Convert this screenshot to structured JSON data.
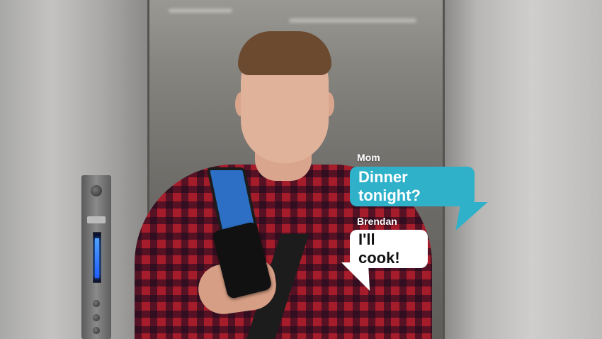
{
  "chat": {
    "incoming": {
      "sender": "Mom",
      "message": "Dinner tonight?"
    },
    "outgoing": {
      "sender": "Brendan",
      "message": "I'll cook!"
    }
  },
  "colors": {
    "incoming_bubble": "#2eb1c9",
    "outgoing_bubble": "#ffffff",
    "incoming_text": "#ffffff",
    "outgoing_text": "#111111"
  }
}
